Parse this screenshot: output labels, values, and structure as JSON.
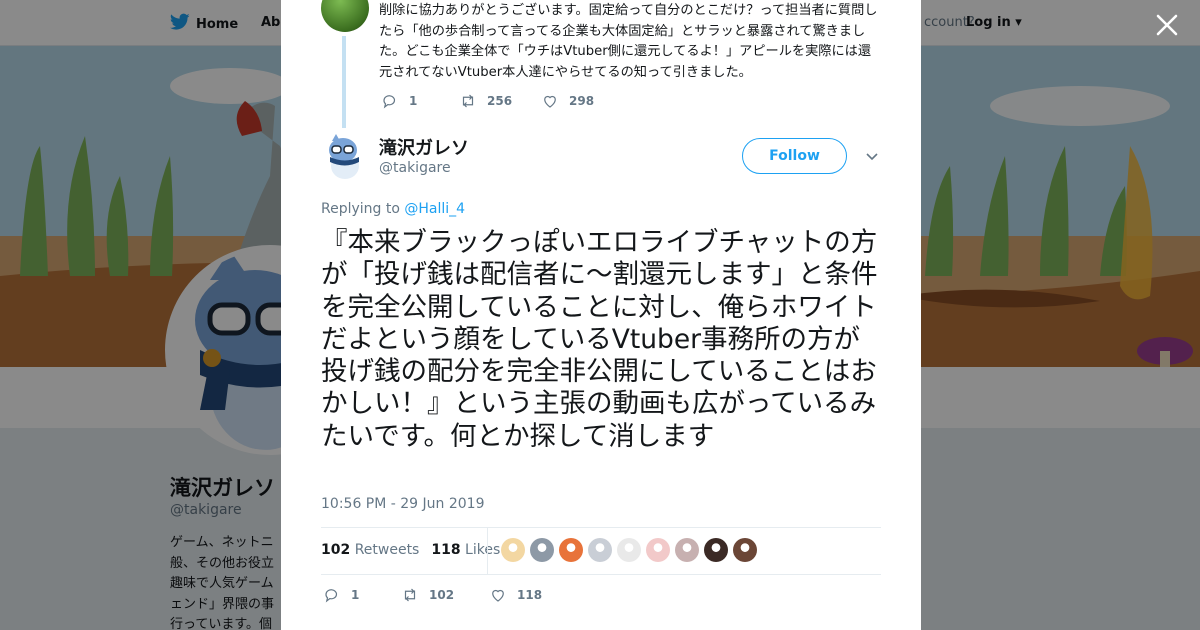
{
  "nav": {
    "home_label": "Home",
    "about_label": "Abo",
    "account_prompt": "ccount?",
    "login_label": "Log in"
  },
  "profile": {
    "name": "滝沢ガレソ",
    "handle": "@takigare",
    "bio": "ゲーム、ネットニ\n般、その他お役立\n趣味で人気ゲーム\nェンド」界隈の事\n行っています。個"
  },
  "parent_tweet": {
    "text": "削除に協力ありがとうございます。固定給って自分のとこだけ？って担当者に質問したら「他の歩合制って言ってる企業も大体固定給」とサラッと暴露されて驚きました。どこも企業全体で「ウチはVtuber側に還元してるよ！」アピールを実際には還元されてないVtuber本人達にやらせてるの知って引きました。",
    "replies": "1",
    "retweets": "256",
    "likes": "298"
  },
  "tweet": {
    "author_name": "滝沢ガレソ",
    "author_handle": "@takigare",
    "follow_label": "Follow",
    "replying_prefix": "Replying to",
    "replying_to": "@Halli_4",
    "text": "『本来ブラックっぽいエロライブチャットの方が「投げ銭は配信者に～割還元します」と条件を完全公開していることに対し、俺らホワイトだよという顔をしているVtuber事務所の方が投げ銭の配分を完全非公開にしていることはおかしい！』という主張の動画も広がっているみたいです。何とか探して消します",
    "timestamp": "10:56 PM - 29 Jun 2019",
    "retweet_count": "102",
    "retweet_label": "Retweets",
    "like_count": "118",
    "like_label": "Likes",
    "replies": "1",
    "retweets": "102",
    "likes": "118"
  },
  "likers": [
    "#f3d7a2",
    "#8d99a6",
    "#e8733a",
    "#c9ced6",
    "#e9e9e9",
    "#f2c9c9",
    "#c7b0b0",
    "#3b2a25",
    "#6b4636"
  ],
  "colors": {
    "accent": "#1da1f2",
    "text": "#14171a",
    "muted": "#657786"
  }
}
